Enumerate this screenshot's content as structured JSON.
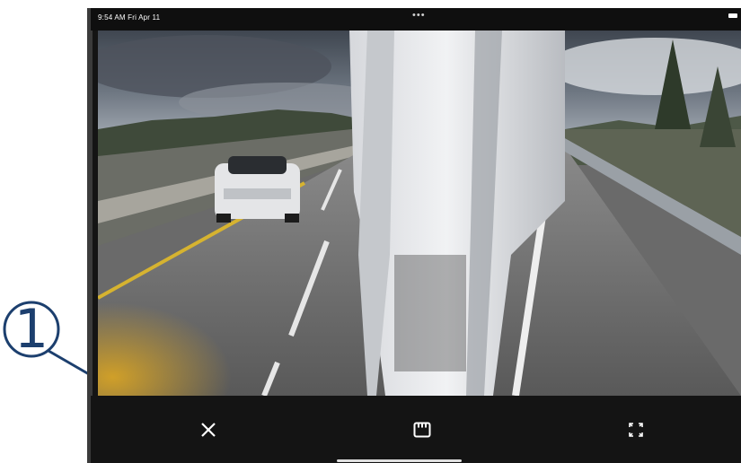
{
  "callout": {
    "number": "1"
  },
  "status_bar": {
    "time": "9:54 AM  Fri Apr 11",
    "multitask_icon": "ellipsis-icon",
    "battery_icon": "battery-icon"
  },
  "camera": {
    "feed": "side-camera-road-view"
  },
  "toolbar": {
    "close_icon": "close-icon",
    "save_icon": "sd-card-icon",
    "fullscreen_icon": "expand-icon"
  },
  "colors": {
    "callout": "#1c3f6e",
    "toolbar_bg": "#141414",
    "icon": "#ffffff"
  }
}
